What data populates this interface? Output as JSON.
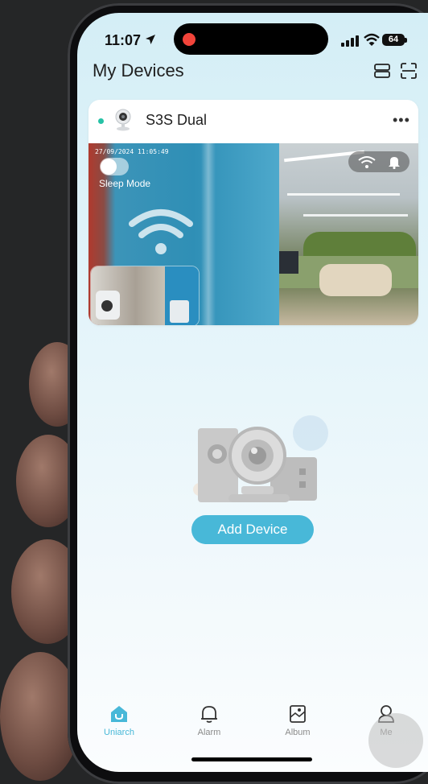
{
  "status_bar": {
    "time": "11:07",
    "battery": "64"
  },
  "header": {
    "title": "My Devices",
    "layout_icon": "layout-icon",
    "scan_icon": "scan-icon"
  },
  "device_card": {
    "name": "S3S Dual",
    "online_color": "#26c2a6",
    "timestamp": "27/09/2024 11:05:49",
    "sleep_mode_label": "Sleep Mode",
    "sleep_mode_on": false
  },
  "empty_state": {
    "add_button": "Add Device"
  },
  "tabs": [
    {
      "label": "Uniarch",
      "icon": "home-icon",
      "active": true
    },
    {
      "label": "Alarm",
      "icon": "bell-icon",
      "active": false
    },
    {
      "label": "Album",
      "icon": "album-icon",
      "active": false
    },
    {
      "label": "Me",
      "icon": "person-icon",
      "active": false
    }
  ],
  "colors": {
    "accent": "#48b8d8",
    "background": "#252627"
  }
}
